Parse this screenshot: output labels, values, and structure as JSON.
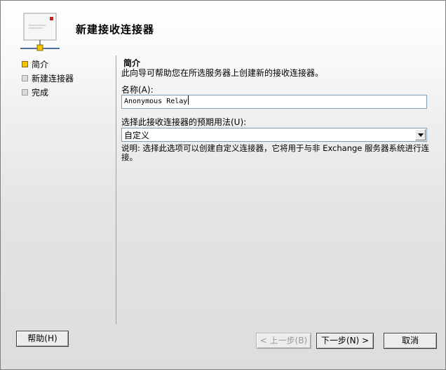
{
  "wizard": {
    "title": "新建接收连接器"
  },
  "steps": [
    {
      "label": "简介",
      "active": true
    },
    {
      "label": "新建连接器",
      "active": false
    },
    {
      "label": "完成",
      "active": false
    }
  ],
  "intro": {
    "heading": "简介",
    "description": "此向导可帮助您在所选服务器上创建新的接收连接器。"
  },
  "name_field": {
    "label": "名称(A):",
    "value": "Anonymous Relay"
  },
  "usage_field": {
    "label": "选择此接收连接器的预期用法(U):",
    "selected": "自定义"
  },
  "note": "说明: 选择此选项可以创建自定义连接器，它将用于与非 Exchange 服务器系统进行连接。",
  "buttons": {
    "help": "帮助(H)",
    "back": "< 上一步(B)",
    "next": "下一步(N) >",
    "cancel": "取消"
  },
  "colors": {
    "active_step": "#f5c200",
    "inactive_step": "#dcdcdc",
    "input_border": "#7f9db9"
  },
  "icons": {
    "header": "connector-envelope-icon",
    "dropdown": "chevron-down-icon"
  }
}
